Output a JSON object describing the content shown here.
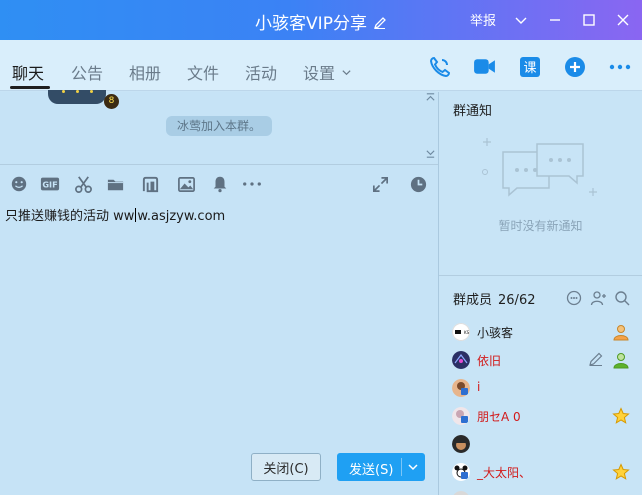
{
  "window": {
    "title": "小骇客VIP分享",
    "report_label": "举报"
  },
  "tabs": [
    {
      "label": "聊天"
    },
    {
      "label": "公告"
    },
    {
      "label": "相册"
    },
    {
      "label": "文件"
    },
    {
      "label": "活动"
    },
    {
      "label": "设置"
    }
  ],
  "history": {
    "system_message": "冰莺加入本群。",
    "level_badge": "8"
  },
  "composer": {
    "text_before": "只推送赚钱的活动  ww",
    "text_after": "w.asjzyw.com"
  },
  "buttons": {
    "close": "关闭(C)",
    "send": "发送(S)"
  },
  "notice": {
    "title": "群通知",
    "empty_text": "暂时没有新通知"
  },
  "members": {
    "title": "群成员",
    "count": "26/62",
    "list": [
      {
        "name": "小骇客",
        "color": "#1a1a1a",
        "role": "owner"
      },
      {
        "name": "依旧",
        "color": "#d21a1a",
        "role": "admin"
      },
      {
        "name": "i",
        "color": "#d21a1a",
        "role": ""
      },
      {
        "name": "朋セA 0",
        "color": "#d21a1a",
        "role": "star"
      },
      {
        "name": "",
        "color": "#1a1a1a",
        "role": ""
      },
      {
        "name": "_大太阳、",
        "color": "#d21a1a",
        "role": "star"
      }
    ]
  },
  "colors": {
    "accent": "#1fa0f3",
    "title_gradient_start": "#2f8ff3",
    "title_gradient_end": "#8a66f2",
    "panel_bg": "#c8e4f6",
    "member_red": "#d21a1a"
  }
}
